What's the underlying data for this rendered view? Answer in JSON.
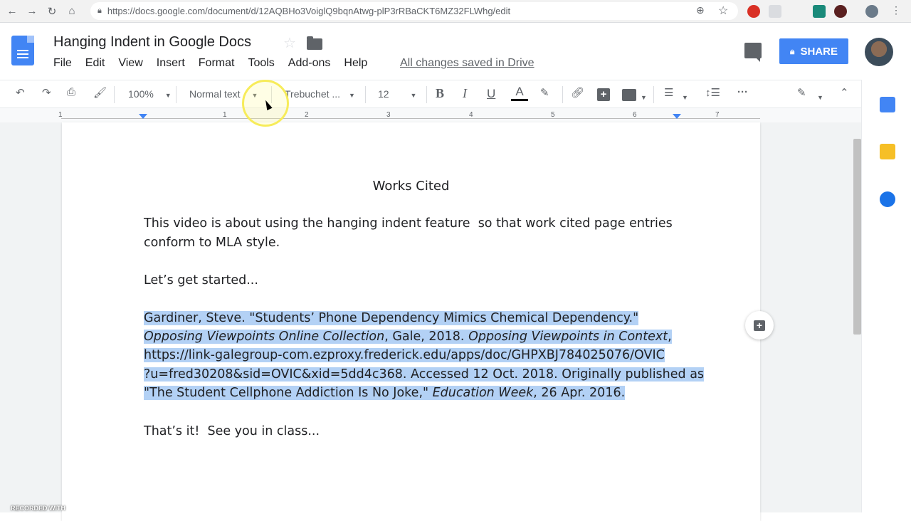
{
  "browser": {
    "url": "https://docs.google.com/document/d/12AQBHo3VoiglQ9bqnAtwg-plP3rRBaCKT6MZ32FLWhg/edit"
  },
  "doc": {
    "title": "Hanging Indent in Google Docs",
    "menu": [
      "File",
      "Edit",
      "View",
      "Insert",
      "Format",
      "Tools",
      "Add-ons",
      "Help"
    ],
    "saved_status": "All changes saved in Drive",
    "share_label": "SHARE"
  },
  "toolbar": {
    "zoom": "100%",
    "style": "Normal text",
    "font": "Trebuchet ...",
    "size": "12",
    "bold": "B",
    "italic": "I",
    "underline": "U",
    "text_color": "A"
  },
  "ruler": {
    "numbers": [
      "1",
      "1",
      "2",
      "3",
      "4",
      "5",
      "6",
      "7"
    ]
  },
  "content": {
    "heading": "Works Cited",
    "p1_line1": "This video is about using the hanging indent feature  so that work cited page entries",
    "p1_line2": "conform to MLA style.",
    "p2": "Let’s get started...",
    "cite": {
      "l1": "Gardiner, Steve. \"Students’ Phone Dependency Mimics Chemical Dependency.\"",
      "l2_i1": "Opposing Viewpoints Online Collection",
      "l2_t1": ", Gale, 2018. ",
      "l2_i2": "Opposing Viewpoints in Context",
      "l2_t2": ",",
      "l3": "https://link-galegroup-com.ezproxy.frederick.edu/apps/doc/GHPXBJ784025076/OVIC",
      "l4": "?u=fred30208&sid=OVIC&xid=5dd4c368. Accessed 12 Oct. 2018. Originally published as",
      "l5_t1": "\"The Student Cellphone Addiction Is No Joke,\" ",
      "l5_i1": "Education Week",
      "l5_t2": ", 26 Apr. 2016."
    },
    "p4": "That’s it!  See you in class..."
  },
  "watermark": "RECORDED WITH",
  "colors": {
    "selection": "#b3d1f5",
    "accent": "#4285f4"
  }
}
